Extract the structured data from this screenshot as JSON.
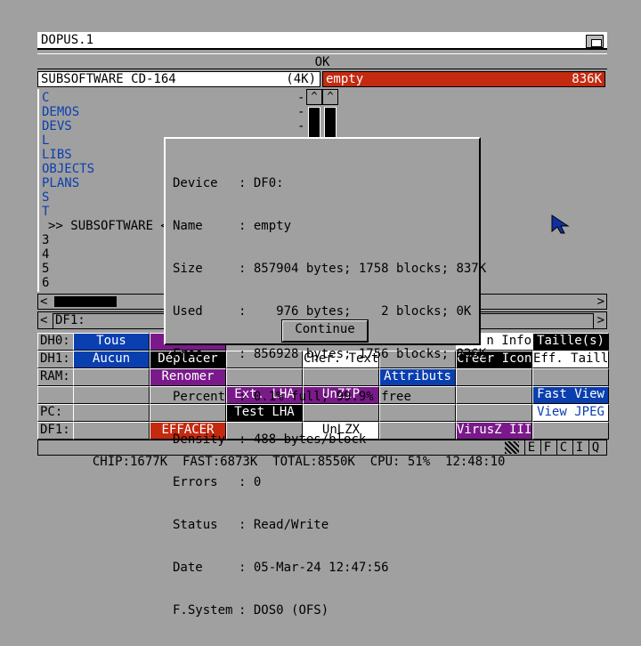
{
  "window": {
    "title": "DOPUS.1"
  },
  "ok_label": "OK",
  "left_lister": {
    "name": "SUBSOFTWARE CD-164",
    "size": "(4K)",
    "entries": [
      "C",
      "DEMOS",
      "DEVS",
      "L",
      "LIBS",
      "OBJECTS",
      "PLANS",
      "S",
      "T",
      ">> SUBSOFTWARE <<",
      "3",
      "4",
      "5",
      "6"
    ]
  },
  "right_lister": {
    "name": "empty",
    "size": "836K"
  },
  "path": {
    "left": "DF1:"
  },
  "dialog": {
    "rows": [
      {
        "label": "Device",
        "value": "DF0:"
      },
      {
        "label": "Name",
        "value": "empty"
      },
      {
        "label": "Size",
        "value": "857904 bytes; 1758 blocks; 837K"
      },
      {
        "label": "Used",
        "value": "   976 bytes;    2 blocks; 0K"
      },
      {
        "label": "Free",
        "value": "856928 bytes; 1756 blocks; 836K"
      },
      {
        "label": "Percent",
        "value": "0.1% full; 99.9% free"
      },
      {
        "label": "Density",
        "value": "488 bytes/block"
      },
      {
        "label": "Errors",
        "value": "0"
      },
      {
        "label": "Status",
        "value": "Read/Write"
      },
      {
        "label": "Date",
        "value": "05-Mar-24 12:47:56"
      },
      {
        "label": "F.System",
        "value": "DOS0 (OFS)"
      }
    ],
    "separator": ":",
    "continue_label": "Continue"
  },
  "devices": [
    "DH0:",
    "DH1:",
    "RAM:",
    "",
    "PC:",
    "DF1:"
  ],
  "buttons": {
    "tous": "Tous",
    "aucun": "Aucun",
    "deplacer": "Déplacer",
    "renommer": "Renomer",
    "ext_lha": "Ext. LHA",
    "test_lha": "Test LHA",
    "effacer": "EFFACER",
    "cher_text": "Cher. Text",
    "unzip": "UnZIP",
    "unlzx": "UnLZX",
    "attributs": "Attributs",
    "creer_icon": "Créer Icon",
    "virusz": "VirusZ III",
    "info": "n Info",
    "tailles": "Taille(s)",
    "eff_taill": "Eff. Taill",
    "fast_view": "Fast View",
    "view_jpeg": "View JPEG"
  },
  "status": {
    "text": "CHIP:1677K  FAST:6873K  TOTAL:8550K  CPU: 51%  12:48:10",
    "gadgets": [
      "E",
      "F",
      "C",
      "I",
      "Q"
    ]
  },
  "colors": {
    "accent_red": "#c42a10",
    "accent_blue": "#0a3fb0",
    "accent_purple": "#7a1a8a",
    "background": "#a0a0a0"
  }
}
